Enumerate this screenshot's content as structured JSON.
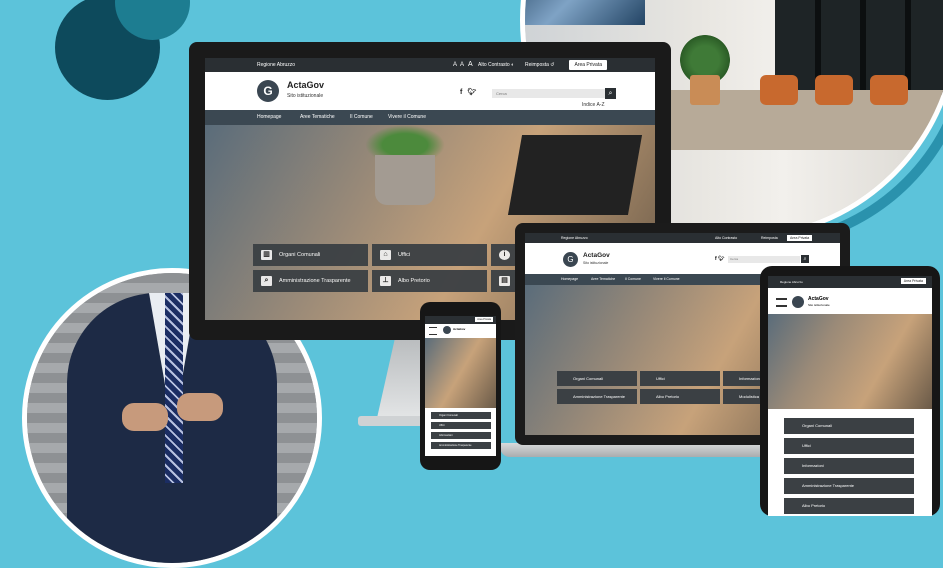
{
  "site": {
    "top_region": "Regione Abruzzo",
    "font_sizes": [
      "A",
      "A",
      "A"
    ],
    "contrast_label": "Alto Contrasto",
    "reset_label": "Reimposta",
    "private_area": "Area Privata",
    "brand": "ActaGov",
    "brand_subtitle": "Sito istituzionale",
    "social": [
      "f",
      "t"
    ],
    "search_placeholder": "Cerca",
    "search_icon": "search-icon",
    "az_index": "Indice A-Z",
    "nav": [
      "Homepage",
      "Aree Tematiche",
      "Il Comune",
      "Vivere il Comune"
    ],
    "tiles": [
      {
        "label": "Organi Comunali",
        "icon": "building-icon"
      },
      {
        "label": "Uffici",
        "icon": "bank-icon"
      },
      {
        "label": "Informazioni",
        "icon": "info-icon"
      },
      {
        "label": "Amministrazione Trasparente",
        "icon": "search-icon"
      },
      {
        "label": "Albo Pretorio",
        "icon": "pin-icon"
      },
      {
        "label": "Modulistica",
        "icon": "document-icon"
      }
    ]
  },
  "colors": {
    "background": "#5cc3da",
    "dark_circle": "#0d4a5c",
    "nav_bar": "#3b4852",
    "top_bar": "#2a2f33"
  }
}
